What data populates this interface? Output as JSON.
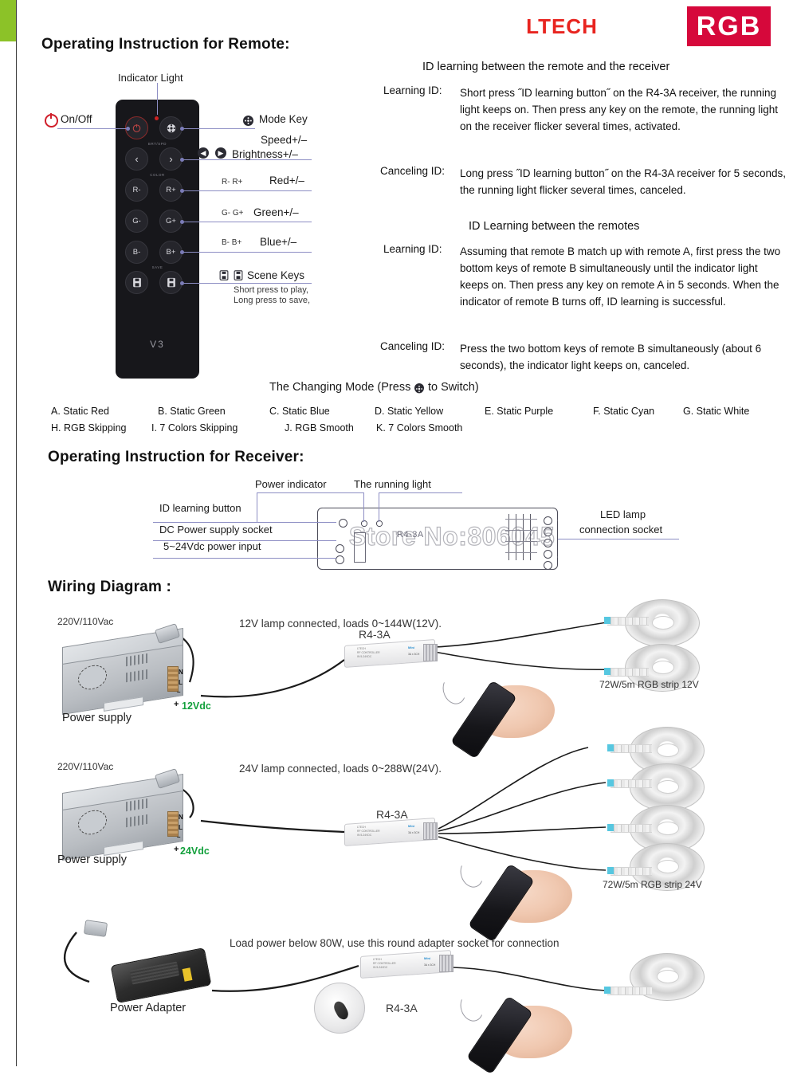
{
  "header": {
    "brand": "LTECH",
    "badge": "RGB"
  },
  "edge_tabs": {
    "red_color": "#d6083b",
    "green_color": "#8cc228"
  },
  "sections": {
    "remote_heading": "Operating Instruction for Remote:",
    "receiver_heading": "Operating Instruction for Receiver:",
    "wiring_heading": "Wiring Diagram :"
  },
  "remote": {
    "version": "V3",
    "group_labels": {
      "brt_spd": "BRT/SPD",
      "color": "COLOR",
      "save": "SAVE"
    },
    "buttons": [
      {
        "key": "power",
        "glyph": "⏻"
      },
      {
        "key": "mode",
        "glyph": ""
      },
      {
        "key": "prev",
        "glyph": "‹"
      },
      {
        "key": "next",
        "glyph": "›"
      },
      {
        "key": "r-minus",
        "glyph": "R-"
      },
      {
        "key": "r-plus",
        "glyph": "R+"
      },
      {
        "key": "g-minus",
        "glyph": "G-"
      },
      {
        "key": "g-plus",
        "glyph": "G+"
      },
      {
        "key": "b-minus",
        "glyph": "B-"
      },
      {
        "key": "b-plus",
        "glyph": "B+"
      },
      {
        "key": "scene-1",
        "glyph": ""
      },
      {
        "key": "scene-2",
        "glyph": ""
      }
    ],
    "callouts": {
      "indicator_light": "Indicator Light",
      "on_off": "On/Off",
      "mode_key": "Mode Key",
      "speed": "Speed+/–",
      "brightness": "Brightness+/–",
      "red_small": "R-  R+",
      "red": "Red+/–",
      "green_small": "G-  G+",
      "green": "Green+/–",
      "blue_small": "B-  B+",
      "blue": "Blue+/–",
      "scene_keys": "Scene Keys",
      "scene_sub1": "Short press to play,",
      "scene_sub2": "Long press to save,"
    }
  },
  "id_learning_receiver": {
    "title": "ID learning between the remote and the receiver",
    "rows": [
      {
        "label": "Learning ID:",
        "text": "Short press ˝ID learning button˝ on the R4-3A receiver, the running light keeps on. Then press any key on the remote, the running light on the receiver flicker several times, activated."
      },
      {
        "label": "Canceling ID:",
        "text": "Long press ˝ID learning button˝ on the R4-3A receiver for 5 seconds, the running light flicker several times, canceled."
      }
    ]
  },
  "id_learning_remotes": {
    "title": "ID Learning between the remotes",
    "rows": [
      {
        "label": "Learning ID:",
        "text": "Assuming that remote B match up with remote A, first press the two bottom keys of remote B simultaneously until the indicator light keeps on. Then press any key on remote A in 5 seconds. When the indicator of remote B turns off, ID learning is successful."
      },
      {
        "label": "Canceling ID:",
        "text": "Press the two bottom keys of remote B simultaneously (about 6 seconds), the indicator light keeps on, canceled."
      }
    ]
  },
  "changing_mode": {
    "title_before": "The Changing Mode (Press",
    "title_after": "to Switch)",
    "modes_row1": [
      "A. Static Red",
      "B. Static Green",
      "C. Static Blue",
      "D. Static Yellow",
      "E. Static Purple",
      "F. Static Cyan",
      "G. Static White"
    ],
    "modes_row2": [
      "H. RGB Skipping",
      "I. 7 Colors Skipping",
      "J. RGB Smooth",
      "K. 7 Colors Smooth"
    ]
  },
  "receiver": {
    "model_label": "R4-3A",
    "watermark": "Store No:806045",
    "labels": {
      "id_learning_button": "ID learning button",
      "dc_power_socket": "DC Power supply socket",
      "power_input": "5~24Vdc power input",
      "power_indicator": "Power indicator",
      "running_light": "The running light",
      "led_socket_line1": "LED lamp",
      "led_socket_line2": "connection socket"
    }
  },
  "wiring": {
    "diagrams": [
      {
        "id": "diagram-12v",
        "ac_input": "220V/110Vac",
        "source_label": "Power supply",
        "dc_output": "12Vdc",
        "load_note": "12V lamp connected, loads 0~144W(12V).",
        "controller": "R4-3A",
        "strip_label": "72W/5m   RGB strip   12V",
        "strip_count": 2,
        "terminal_n": "N",
        "terminal_l": "L",
        "terminal_minus": "–",
        "terminal_plus": "+"
      },
      {
        "id": "diagram-24v",
        "ac_input": "220V/110Vac",
        "source_label": "Power supply",
        "dc_output": "24Vdc",
        "load_note": "24V lamp connected, loads 0~288W(24V).",
        "controller": "R4-3A",
        "strip_label": "72W/5m   RGB strip   24V",
        "strip_count": 4,
        "terminal_n": "N",
        "terminal_l": "L",
        "terminal_minus": "–",
        "terminal_plus": "+"
      },
      {
        "id": "diagram-adapter",
        "source_label": "Power Adapter",
        "load_note": "Load power below 80W, use this round adapter socket for connection",
        "controller": "R4-3A",
        "strip_count": 1
      }
    ]
  }
}
